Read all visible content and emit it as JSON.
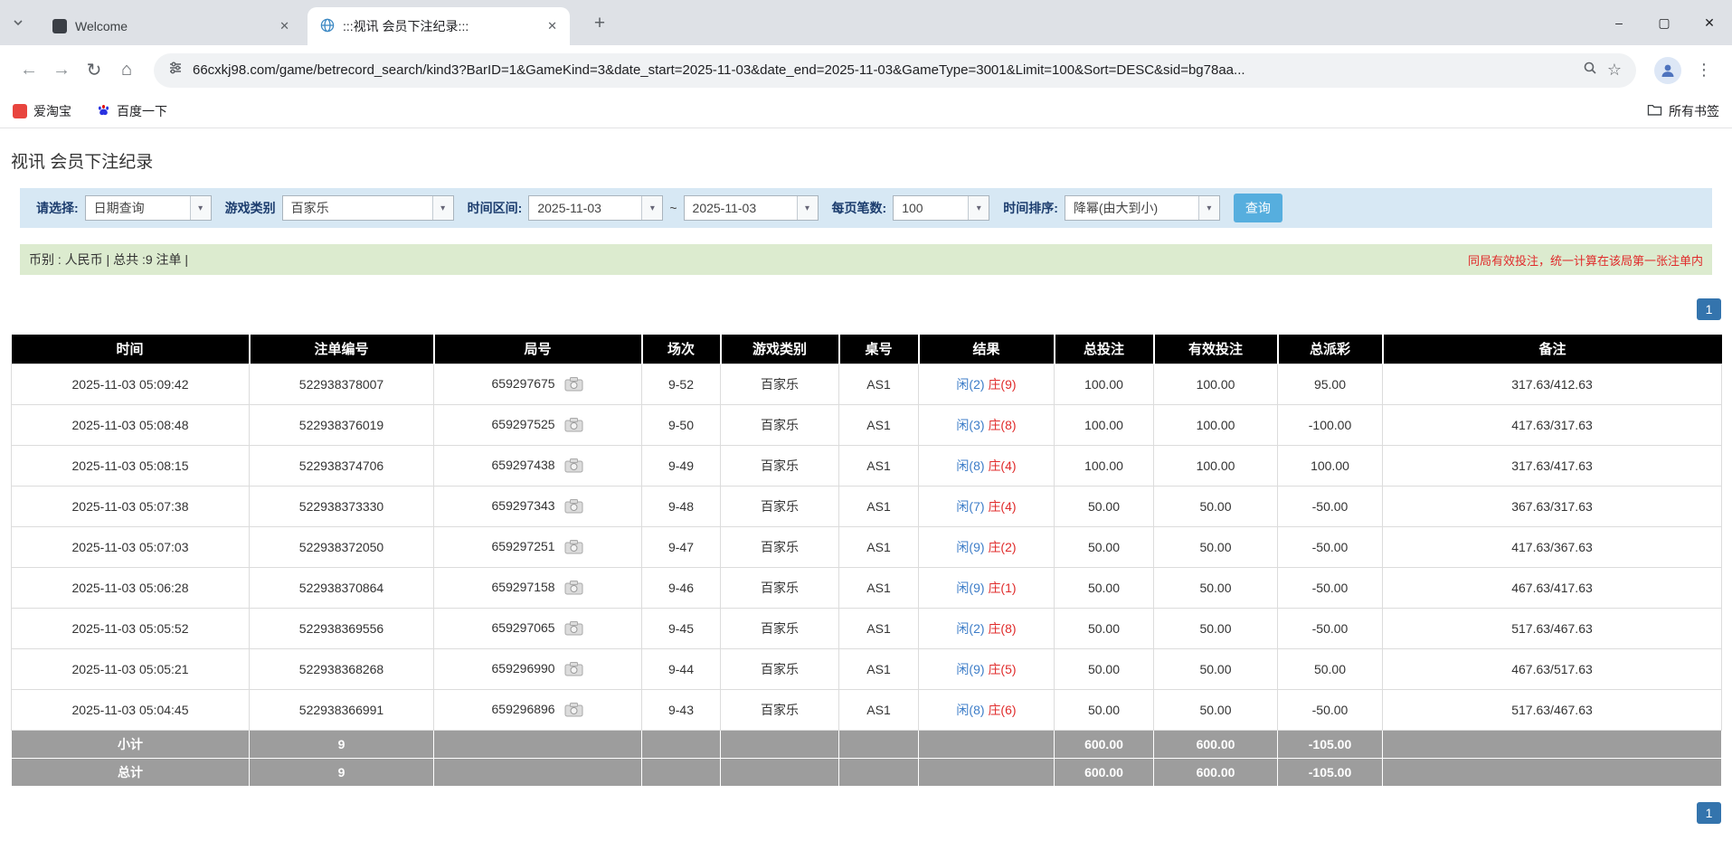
{
  "colors": {
    "accent": "#3474ad",
    "button_blue": "#56aede",
    "value_blue": "#3d7dc8",
    "loss_red": "#e02b2b",
    "table_header_bg": "#000000",
    "table_footer_bg": "#9d9d9d",
    "filter_bar_bg": "#d7e8f4",
    "info_bar_bg": "#dcebcf"
  },
  "browser": {
    "tabs": [
      {
        "title": "Welcome"
      },
      {
        "title": ":::视讯 会员下注纪录:::"
      }
    ],
    "url": "66cxkj98.com/game/betrecord_search/kind3?BarID=1&GameKind=3&date_start=2025-11-03&date_end=2025-11-03&GameType=3001&Limit=100&Sort=DESC&sid=bg78aa...",
    "bookmarks": [
      {
        "label": "爱淘宝"
      },
      {
        "label": "百度一下"
      }
    ],
    "all_bookmarks_label": "所有书签"
  },
  "page": {
    "title": "视讯 会员下注纪录",
    "filters": {
      "select_label": "请选择:",
      "select_value": "日期查询",
      "game_type_label": "游戏类别",
      "game_type_value": "百家乐",
      "date_range_label": "时间区间:",
      "date_start": "2025-11-03",
      "tilde": "~",
      "date_end": "2025-11-03",
      "per_page_label": "每页笔数:",
      "per_page_value": "100",
      "sort_label": "时间排序:",
      "sort_value": "降幂(由大到小)",
      "search_button": "查询"
    },
    "info_bar": {
      "left": "币别 : 人民币 | 总共 :9 注单 |",
      "right": "同局有效投注，统一计算在该局第一张注单内"
    },
    "pagination": "1",
    "table": {
      "headers": [
        "时间",
        "注单编号",
        "局号",
        "场次",
        "游戏类别",
        "桌号",
        "结果",
        "总投注",
        "有效投注",
        "总派彩",
        "备注"
      ],
      "rows": [
        {
          "time": "2025-11-03 05:09:42",
          "bet_id": "522938378007",
          "round_id": "659297675",
          "session": "9-52",
          "game": "百家乐",
          "table": "AS1",
          "result_player": "闲(2)",
          "result_banker": "庄(9)",
          "total_bet": "100.00",
          "valid_bet": "100.00",
          "payout": "95.00",
          "note": "317.63/412.63"
        },
        {
          "time": "2025-11-03 05:08:48",
          "bet_id": "522938376019",
          "round_id": "659297525",
          "session": "9-50",
          "game": "百家乐",
          "table": "AS1",
          "result_player": "闲(3)",
          "result_banker": "庄(8)",
          "total_bet": "100.00",
          "valid_bet": "100.00",
          "payout": "-100.00",
          "note": "417.63/317.63"
        },
        {
          "time": "2025-11-03 05:08:15",
          "bet_id": "522938374706",
          "round_id": "659297438",
          "session": "9-49",
          "game": "百家乐",
          "table": "AS1",
          "result_player": "闲(8)",
          "result_banker": "庄(4)",
          "total_bet": "100.00",
          "valid_bet": "100.00",
          "payout": "100.00",
          "note": "317.63/417.63"
        },
        {
          "time": "2025-11-03 05:07:38",
          "bet_id": "522938373330",
          "round_id": "659297343",
          "session": "9-48",
          "game": "百家乐",
          "table": "AS1",
          "result_player": "闲(7)",
          "result_banker": "庄(4)",
          "total_bet": "50.00",
          "valid_bet": "50.00",
          "payout": "-50.00",
          "note": "367.63/317.63"
        },
        {
          "time": "2025-11-03 05:07:03",
          "bet_id": "522938372050",
          "round_id": "659297251",
          "session": "9-47",
          "game": "百家乐",
          "table": "AS1",
          "result_player": "闲(9)",
          "result_banker": "庄(2)",
          "total_bet": "50.00",
          "valid_bet": "50.00",
          "payout": "-50.00",
          "note": "417.63/367.63"
        },
        {
          "time": "2025-11-03 05:06:28",
          "bet_id": "522938370864",
          "round_id": "659297158",
          "session": "9-46",
          "game": "百家乐",
          "table": "AS1",
          "result_player": "闲(9)",
          "result_banker": "庄(1)",
          "total_bet": "50.00",
          "valid_bet": "50.00",
          "payout": "-50.00",
          "note": "467.63/417.63"
        },
        {
          "time": "2025-11-03 05:05:52",
          "bet_id": "522938369556",
          "round_id": "659297065",
          "session": "9-45",
          "game": "百家乐",
          "table": "AS1",
          "result_player": "闲(2)",
          "result_banker": "庄(8)",
          "total_bet": "50.00",
          "valid_bet": "50.00",
          "payout": "-50.00",
          "note": "517.63/467.63"
        },
        {
          "time": "2025-11-03 05:05:21",
          "bet_id": "522938368268",
          "round_id": "659296990",
          "session": "9-44",
          "game": "百家乐",
          "table": "AS1",
          "result_player": "闲(9)",
          "result_banker": "庄(5)",
          "total_bet": "50.00",
          "valid_bet": "50.00",
          "payout": "50.00",
          "note": "467.63/517.63"
        },
        {
          "time": "2025-11-03 05:04:45",
          "bet_id": "522938366991",
          "round_id": "659296896",
          "session": "9-43",
          "game": "百家乐",
          "table": "AS1",
          "result_player": "闲(8)",
          "result_banker": "庄(6)",
          "total_bet": "50.00",
          "valid_bet": "50.00",
          "payout": "-50.00",
          "note": "517.63/467.63"
        }
      ],
      "subtotal": {
        "label": "小计",
        "count": "9",
        "total_bet": "600.00",
        "valid_bet": "600.00",
        "payout": "-105.00"
      },
      "total": {
        "label": "总计",
        "count": "9",
        "total_bet": "600.00",
        "valid_bet": "600.00",
        "payout": "-105.00"
      }
    }
  }
}
